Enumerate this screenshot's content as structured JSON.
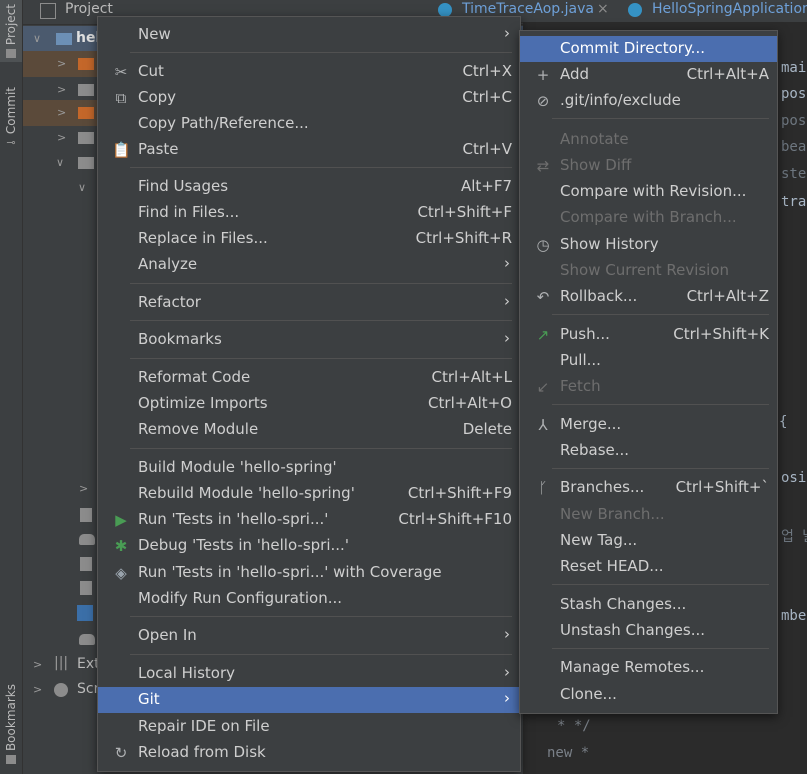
{
  "toolstrip": {
    "project": "Project",
    "commit": "Commit",
    "bookmarks": "Bookmarks"
  },
  "project_panel": {
    "title": "Project",
    "root_label": "hel",
    "ext_label": "Ext",
    "scr_label": "Scr"
  },
  "tabs": [
    {
      "label": "TimeTraceAop.java"
    },
    {
      "label": "HelloSpringApplication"
    }
  ],
  "editor_lines": [
    "mai",
    "pos",
    "pos",
    "bea",
    "ste",
    "tra",
    "{",
    "osi",
    "업 날",
    "mbe",
    "* */",
    "new *"
  ],
  "context_menu": [
    {
      "label": "New",
      "submenu": true
    },
    {
      "label": "Cut",
      "shortcut": "Ctrl+X",
      "icon": "scissors-icon"
    },
    {
      "label": "Copy",
      "shortcut": "Ctrl+C",
      "icon": "copy-icon"
    },
    {
      "label": "Copy Path/Reference..."
    },
    {
      "label": "Paste",
      "shortcut": "Ctrl+V",
      "icon": "paste-icon"
    },
    {
      "label": "Find Usages",
      "shortcut": "Alt+F7"
    },
    {
      "label": "Find in Files...",
      "shortcut": "Ctrl+Shift+F"
    },
    {
      "label": "Replace in Files...",
      "shortcut": "Ctrl+Shift+R"
    },
    {
      "label": "Analyze",
      "submenu": true
    },
    {
      "label": "Refactor",
      "submenu": true
    },
    {
      "label": "Bookmarks",
      "submenu": true
    },
    {
      "label": "Reformat Code",
      "shortcut": "Ctrl+Alt+L"
    },
    {
      "label": "Optimize Imports",
      "shortcut": "Ctrl+Alt+O"
    },
    {
      "label": "Remove Module",
      "shortcut": "Delete"
    },
    {
      "label": "Build Module 'hello-spring'"
    },
    {
      "label": "Rebuild Module 'hello-spring'",
      "shortcut": "Ctrl+Shift+F9"
    },
    {
      "label": "Run 'Tests in 'hello-spri...'",
      "shortcut": "Ctrl+Shift+F10",
      "icon": "run-icon"
    },
    {
      "label": "Debug 'Tests in 'hello-spri...'",
      "icon": "debug-icon"
    },
    {
      "label": "Run 'Tests in 'hello-spri...' with Coverage",
      "icon": "coverage-icon"
    },
    {
      "label": "Modify Run Configuration..."
    },
    {
      "label": "Open In",
      "submenu": true
    },
    {
      "label": "Local History",
      "submenu": true
    },
    {
      "label": "Git",
      "submenu": true,
      "selected": true
    },
    {
      "label": "Repair IDE on File"
    },
    {
      "label": "Reload from Disk",
      "icon": "reload-icon"
    }
  ],
  "git_submenu": [
    {
      "label": "Commit Directory...",
      "selected": true
    },
    {
      "label": "Add",
      "shortcut": "Ctrl+Alt+A",
      "icon": "plus-icon"
    },
    {
      "label": ".git/info/exclude",
      "icon": "ignore-file-icon"
    },
    {
      "label": "Annotate",
      "disabled": true
    },
    {
      "label": "Show Diff",
      "disabled": true,
      "icon": "diff-icon"
    },
    {
      "label": "Compare with Revision..."
    },
    {
      "label": "Compare with Branch...",
      "disabled": true
    },
    {
      "label": "Show History",
      "icon": "history-icon"
    },
    {
      "label": "Show Current Revision",
      "disabled": true
    },
    {
      "label": "Rollback...",
      "shortcut": "Ctrl+Alt+Z",
      "icon": "rollback-icon"
    },
    {
      "label": "Push...",
      "shortcut": "Ctrl+Shift+K",
      "icon": "push-icon"
    },
    {
      "label": "Pull..."
    },
    {
      "label": "Fetch",
      "disabled": true,
      "icon": "fetch-icon"
    },
    {
      "label": "Merge...",
      "icon": "merge-icon"
    },
    {
      "label": "Rebase..."
    },
    {
      "label": "Branches...",
      "shortcut": "Ctrl+Shift+`",
      "icon": "branch-icon"
    },
    {
      "label": "New Branch...",
      "disabled": true
    },
    {
      "label": "New Tag..."
    },
    {
      "label": "Reset HEAD..."
    },
    {
      "label": "Stash Changes..."
    },
    {
      "label": "Unstash Changes..."
    },
    {
      "label": "Manage Remotes..."
    },
    {
      "label": "Clone..."
    }
  ],
  "colors": {
    "selection": "#4b6eaf",
    "run_green": "#499c54",
    "accent_blue": "#3592c4"
  }
}
